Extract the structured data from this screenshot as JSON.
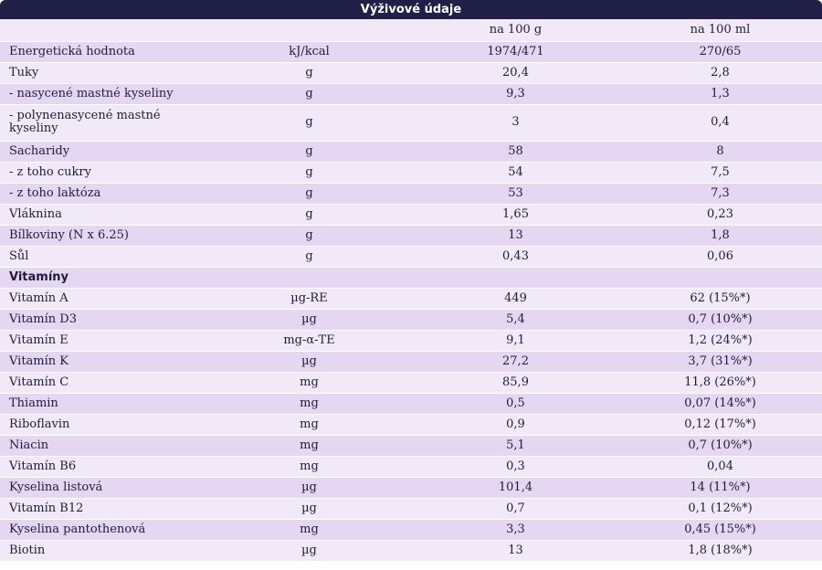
{
  "table": {
    "title": "Výživové údaje",
    "header": [
      "",
      "",
      "na 100 g",
      "na 100 ml"
    ],
    "rows": [
      {
        "cells": [
          "Energetická hodnota",
          "kJ/kcal",
          "1974/471",
          "270/65"
        ]
      },
      {
        "cells": [
          "Tuky",
          "g",
          "20,4",
          "2,8"
        ]
      },
      {
        "cells": [
          "- nasycené mastné kyseliny",
          "g",
          "9,3",
          "1,3"
        ]
      },
      {
        "cells": [
          "- polynenasycené mastné kyseliny",
          "g",
          "3",
          "0,4"
        ]
      },
      {
        "cells": [
          "Sacharidy",
          "g",
          "58",
          "8"
        ]
      },
      {
        "cells": [
          "- z toho cukry",
          "g",
          "54",
          "7,5"
        ]
      },
      {
        "cells": [
          "- z toho laktóza",
          "g",
          "53",
          "7,3"
        ]
      },
      {
        "cells": [
          "Vláknina",
          "g",
          "1,65",
          "0,23"
        ]
      },
      {
        "cells": [
          "Bílkoviny (N x 6.25)",
          "g",
          "13",
          "1,8"
        ]
      },
      {
        "cells": [
          "Sůl",
          "g",
          "0,43",
          "0,06"
        ]
      },
      {
        "section": "Vitamíny",
        "cells": []
      },
      {
        "cells": [
          "Vitamín A",
          "µg-RE",
          "449",
          "62 (15%*)"
        ]
      },
      {
        "cells": [
          "Vitamín D3",
          "µg",
          "5,4",
          "0,7 (10%*)"
        ]
      },
      {
        "cells": [
          "Vitamín E",
          "mg-α-TE",
          "9,1",
          "1,2 (24%*)"
        ]
      },
      {
        "cells": [
          "Vitamín K",
          "µg",
          "27,2",
          "3,7 (31%*)"
        ]
      },
      {
        "cells": [
          "Vitamín C",
          "mg",
          "85,9",
          "11,8 (26%*)"
        ]
      },
      {
        "cells": [
          "Thiamin",
          "mg",
          "0,5",
          "0,07 (14%*)"
        ]
      },
      {
        "cells": [
          "Riboflavin",
          "mg",
          "0,9",
          "0,12 (17%*)"
        ]
      },
      {
        "cells": [
          "Niacin",
          "mg",
          "5,1",
          "0,7 (10%*)"
        ]
      },
      {
        "cells": [
          "Vitamín B6",
          "mg",
          "0,3",
          "0,04"
        ]
      },
      {
        "cells": [
          "Kyselina listová",
          "µg",
          "101,4",
          "14 (11%*)"
        ]
      },
      {
        "cells": [
          "Vitamín B12",
          "µg",
          "0,7",
          "0,1 (12%*)"
        ]
      },
      {
        "cells": [
          "Kyselina pantothenová",
          "mg",
          "3,3",
          "0,45 (15%*)"
        ]
      },
      {
        "cells": [
          "Biotin",
          "µg",
          "13",
          "1,8 (18%*)"
        ]
      }
    ]
  },
  "colors": {
    "header_bg": "#1f1f48",
    "row_dark": "#e5d6f2",
    "row_light": "#f1e8f8"
  }
}
